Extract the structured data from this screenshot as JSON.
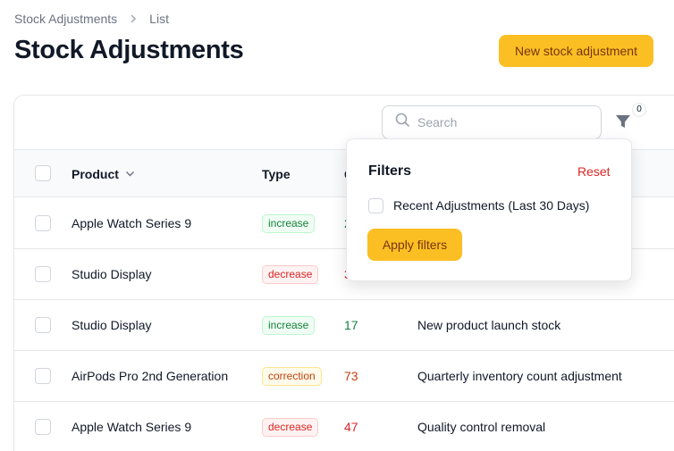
{
  "breadcrumb": {
    "items": [
      "Stock Adjustments",
      "List"
    ]
  },
  "page": {
    "title": "Stock Adjustments",
    "new_button": "New stock adjustment"
  },
  "toolbar": {
    "search_placeholder": "Search",
    "filter_count": "0"
  },
  "table": {
    "headers": {
      "product": "Product",
      "type": "Type",
      "quantity": "Q"
    },
    "rows": [
      {
        "product": "Apple Watch Series 9",
        "type": "increase",
        "quantity": "2",
        "reason": ""
      },
      {
        "product": "Studio Display",
        "type": "decrease",
        "quantity": "3",
        "reason": ""
      },
      {
        "product": "Studio Display",
        "type": "increase",
        "quantity": "17",
        "reason": "New product launch stock"
      },
      {
        "product": "AirPods Pro 2nd Generation",
        "type": "correction",
        "quantity": "73",
        "reason": "Quarterly inventory count adjustment"
      },
      {
        "product": "Apple Watch Series 9",
        "type": "decrease",
        "quantity": "47",
        "reason": "Quality control removal"
      }
    ]
  },
  "filters": {
    "title": "Filters",
    "reset": "Reset",
    "option_label": "Recent Adjustments (Last 30 Days)",
    "apply": "Apply filters"
  },
  "colors": {
    "accent": "#fbbf24",
    "increase": "#15803d",
    "decrease": "#dc2626",
    "correction": "#c2410c"
  }
}
